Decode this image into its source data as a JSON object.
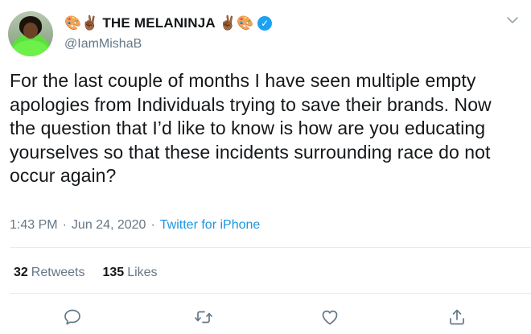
{
  "tweet": {
    "display_name": "THE MELANINJA",
    "name_emoji_left": "🎨✌🏾",
    "name_emoji_right": "✌🏾🎨",
    "handle": "@IamMishaB",
    "text": "For the last couple of months I have seen multiple empty apologies from Individuals trying to save their brands. Now the question that I’d like to know is how are you educating yourselves so that these incidents surrounding race do not occur again?",
    "time": "1:43 PM",
    "date": "Jun 24, 2020",
    "separator": "·",
    "source": "Twitter for iPhone",
    "retweets_count": "32",
    "retweets_label": "Retweets",
    "likes_count": "135",
    "likes_label": "Likes"
  },
  "colors": {
    "accent": "#1da1f2",
    "secondary_text": "#657786",
    "link": "#1b95e0"
  },
  "icons": [
    "verified-badge-icon",
    "chevron-down-icon",
    "reply-icon",
    "retweet-icon",
    "like-icon",
    "share-icon"
  ]
}
